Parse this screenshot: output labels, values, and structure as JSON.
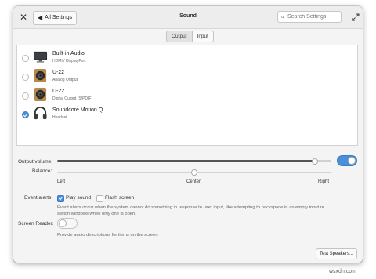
{
  "window": {
    "title": "Sound",
    "close_icon": "close-icon",
    "back_label": "All Settings",
    "search_placeholder": "Search Settings"
  },
  "tabs": [
    {
      "label": "Output",
      "active": true
    },
    {
      "label": "Input",
      "active": false
    }
  ],
  "devices": [
    {
      "name": "Built-in Audio",
      "sub": "HDMI / DisplayPort",
      "icon": "monitor-icon",
      "selected": false
    },
    {
      "name": "U-22",
      "sub": "Analog Output",
      "icon": "speaker-icon",
      "selected": false
    },
    {
      "name": "U-22",
      "sub": "Digital Output (S/PDIF)",
      "icon": "speaker-icon",
      "selected": false
    },
    {
      "name": "Soundcore Motion Q",
      "sub": "Headset",
      "icon": "headphones-icon",
      "selected": true
    }
  ],
  "output_volume": {
    "label": "Output volume:",
    "value_fraction": 0.94,
    "enabled": true
  },
  "balance": {
    "label": "Balance:",
    "left": "Left",
    "center": "Center",
    "right": "Right",
    "value_fraction": 0.5
  },
  "event_alerts": {
    "label": "Event alerts:",
    "play_sound": "Play sound",
    "play_sound_checked": true,
    "flash_screen": "Flash screen",
    "flash_screen_checked": false,
    "description": "Event alerts occur when the system cannot do something in response to user input, like attempting to backspace in an empty input or switch windows when only one is open."
  },
  "screen_reader": {
    "label": "Screen Reader:",
    "enabled": false,
    "description": "Provide audio descriptions for items on the screen"
  },
  "test_button": "Test Speakers...",
  "watermark": "wsxdn.com",
  "colors": {
    "accent": "#4b8fd8"
  }
}
